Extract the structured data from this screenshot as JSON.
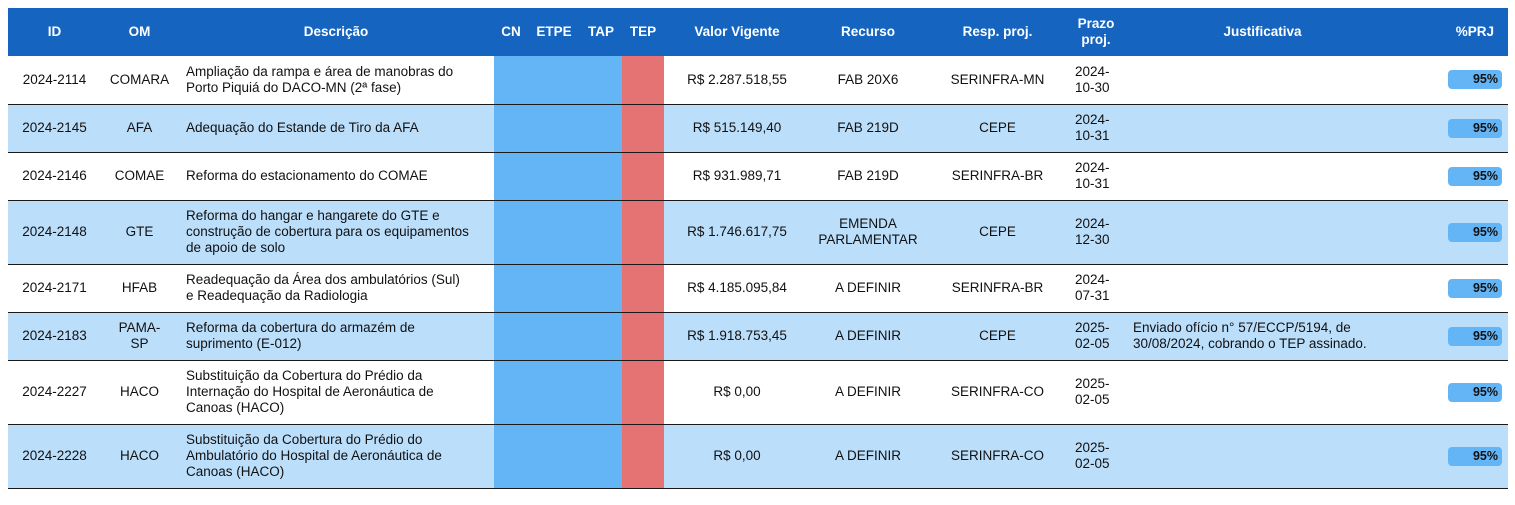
{
  "headers": {
    "id": "ID",
    "om": "OM",
    "descricao": "Descrição",
    "cn": "CN",
    "etpe": "ETPE",
    "tap": "TAP",
    "tep": "TEP",
    "valor": "Valor Vigente",
    "recurso": "Recurso",
    "resp": "Resp. proj.",
    "prazo_line1": "Prazo",
    "prazo_line2": "proj.",
    "justificativa": "Justificativa",
    "prj": "%PRJ"
  },
  "colors": {
    "header_bg": "#1565c0",
    "row_alt": "#bbdefb",
    "status_blue": "#64b5f6",
    "status_red": "#e57373"
  },
  "rows": [
    {
      "id": "2024-2114",
      "om": [
        "COMARA"
      ],
      "descricao": [
        "Ampliação da rampa e área de manobras do",
        "Porto Piquiá do DACO-MN (2ª fase)"
      ],
      "valor": "R$ 2.287.518,55",
      "recurso": [
        "FAB 20X6"
      ],
      "resp": "SERINFRA-MN",
      "prazo": [
        "2024-",
        "10-30"
      ],
      "justificativa": [],
      "prj": "95%"
    },
    {
      "id": "2024-2145",
      "om": [
        "AFA"
      ],
      "descricao": [
        "Adequação do Estande de Tiro da AFA"
      ],
      "valor": "R$ 515.149,40",
      "recurso": [
        "FAB 219D"
      ],
      "resp": "CEPE",
      "prazo": [
        "2024-",
        "10-31"
      ],
      "justificativa": [],
      "prj": "95%"
    },
    {
      "id": "2024-2146",
      "om": [
        "COMAE"
      ],
      "descricao": [
        "Reforma do estacionamento do COMAE"
      ],
      "valor": "R$ 931.989,71",
      "recurso": [
        "FAB 219D"
      ],
      "resp": "SERINFRA-BR",
      "prazo": [
        "2024-",
        "10-31"
      ],
      "justificativa": [],
      "prj": "95%"
    },
    {
      "id": "2024-2148",
      "om": [
        "GTE"
      ],
      "descricao": [
        "Reforma do hangar e hangarete do GTE e",
        "construção de cobertura para os equipamentos",
        "de apoio de solo"
      ],
      "valor": "R$ 1.746.617,75",
      "recurso": [
        "EMENDA",
        "PARLAMENTAR"
      ],
      "resp": "CEPE",
      "prazo": [
        "2024-",
        "12-30"
      ],
      "justificativa": [],
      "prj": "95%"
    },
    {
      "id": "2024-2171",
      "om": [
        "HFAB"
      ],
      "descricao": [
        "Readequação da Área dos ambulatórios (Sul)",
        "e Readequação da Radiologia"
      ],
      "valor": "R$ 4.185.095,84",
      "recurso": [
        "A DEFINIR"
      ],
      "resp": "SERINFRA-BR",
      "prazo": [
        "2024-",
        "07-31"
      ],
      "justificativa": [],
      "prj": "95%"
    },
    {
      "id": "2024-2183",
      "om": [
        "PAMA-",
        "SP"
      ],
      "descricao": [
        "Reforma da cobertura do armazém de",
        "suprimento (E-012)"
      ],
      "valor": "R$ 1.918.753,45",
      "recurso": [
        "A DEFINIR"
      ],
      "resp": "CEPE",
      "prazo": [
        "2025-",
        "02-05"
      ],
      "justificativa": [
        "Enviado ofício n° 57/ECCP/5194, de",
        "30/08/2024, cobrando o TEP assinado."
      ],
      "prj": "95%"
    },
    {
      "id": "2024-2227",
      "om": [
        "HACO"
      ],
      "descricao": [
        "Substituição da Cobertura do Prédio da",
        "Internação do Hospital de Aeronáutica de",
        "Canoas (HACO)"
      ],
      "valor": "R$ 0,00",
      "recurso": [
        "A DEFINIR"
      ],
      "resp": "SERINFRA-CO",
      "prazo": [
        "2025-",
        "02-05"
      ],
      "justificativa": [],
      "prj": "95%"
    },
    {
      "id": "2024-2228",
      "om": [
        "HACO"
      ],
      "descricao": [
        "Substituição da Cobertura do Prédio do",
        "Ambulatório do Hospital de Aeronáutica de",
        "Canoas (HACO)"
      ],
      "valor": "R$ 0,00",
      "recurso": [
        "A DEFINIR"
      ],
      "resp": "SERINFRA-CO",
      "prazo": [
        "2025-",
        "02-05"
      ],
      "justificativa": [],
      "prj": "95%"
    }
  ]
}
